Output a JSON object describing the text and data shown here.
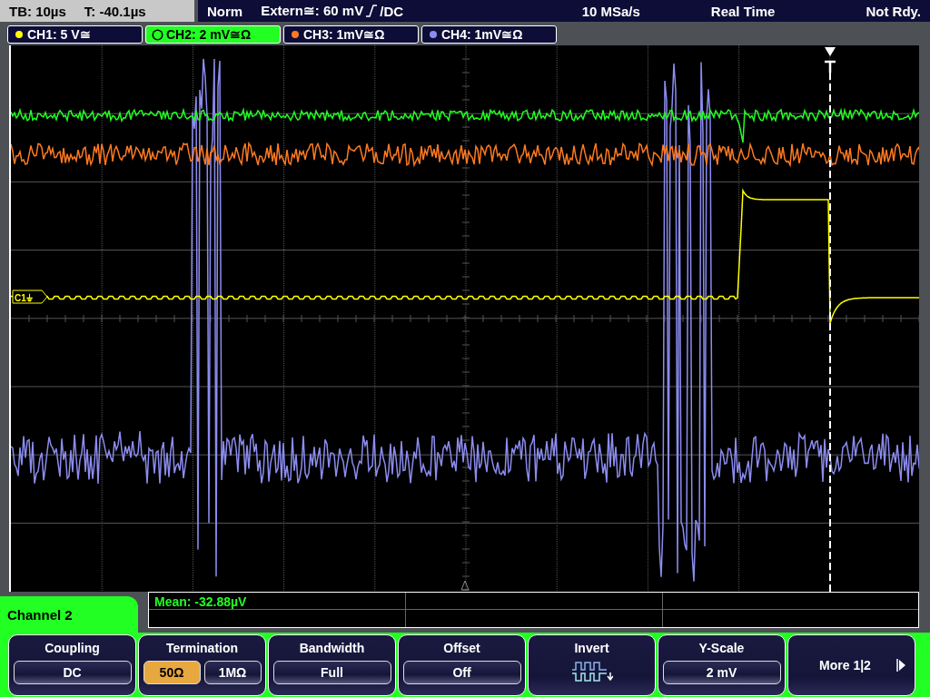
{
  "status_bar": {
    "timebase": "TB: 10µs",
    "trigger_time": "T: -40.1µs",
    "mode": "Norm",
    "trigger_source": "Extern≅: 60 mV",
    "trigger_coupling": "/DC",
    "sample_rate": "10 MSa/s",
    "acquisition": "Real Time",
    "state": "Not Rdy."
  },
  "channel_tabs": [
    {
      "label": "CH1: 5 V≅",
      "color": "#ffff00",
      "selected": false
    },
    {
      "label": "CH2: 2 mV≅Ω",
      "color": "#22ff22",
      "selected": true
    },
    {
      "label": "CH3: 1mV≅Ω",
      "color": "#ff7a20",
      "selected": false
    },
    {
      "label": "CH4: 1mV≅Ω",
      "color": "#8c8cf0",
      "selected": false
    }
  ],
  "display": {
    "markers": [
      {
        "label": "C1⏚",
        "color": "#ffff00"
      }
    ]
  },
  "measurement": {
    "text": "Mean: -32.88µV"
  },
  "menu": {
    "title": "Channel 2",
    "softkeys": [
      {
        "kind": "value",
        "label": "Coupling",
        "value": "DC"
      },
      {
        "kind": "options",
        "label": "Termination",
        "options": [
          {
            "text": "50Ω",
            "selected": true
          },
          {
            "text": "1MΩ",
            "selected": false
          }
        ]
      },
      {
        "kind": "value",
        "label": "Bandwidth",
        "value": "Full"
      },
      {
        "kind": "value",
        "label": "Offset",
        "value": "Off"
      },
      {
        "kind": "icon",
        "label": "Invert"
      },
      {
        "kind": "value",
        "label": "Y-Scale",
        "value": "2 mV"
      },
      {
        "kind": "more",
        "label": "More 1|2"
      }
    ]
  }
}
